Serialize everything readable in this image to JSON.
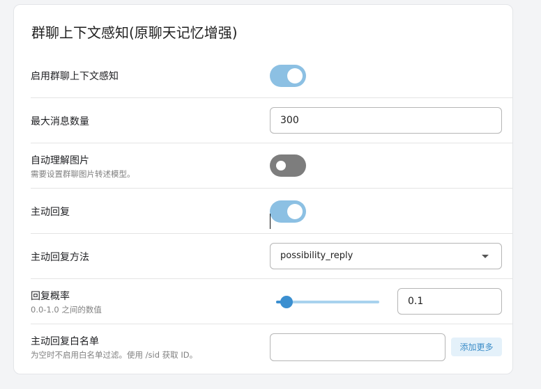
{
  "section": {
    "title": "群聊上下文感知(原聊天记忆增强)"
  },
  "settings": {
    "enable_context": {
      "label": "启用群聊上下文感知",
      "value": true
    },
    "max_messages": {
      "label": "最大消息数量",
      "value": "300"
    },
    "image_understanding": {
      "label": "自动理解图片",
      "description": "需要设置群聊图片转述模型。",
      "value": false
    },
    "active_reply": {
      "label": "主动回复",
      "value": true
    },
    "reply_method": {
      "label": "主动回复方法",
      "selected": "possibility_reply"
    },
    "reply_probability": {
      "label": "回复概率",
      "description": "0.0-1.0 之间的数值",
      "value": "0.1",
      "slider_level": 0.1
    },
    "whitelist": {
      "label": "主动回复白名单",
      "description": "为空时不启用白名单过滤。使用 /sid 获取 ID。",
      "value": "",
      "add_button": "添加更多"
    }
  },
  "colors": {
    "toggle_on": "#8cc0e3",
    "toggle_off": "#7d7d7d",
    "accent": "#3b8fd0"
  }
}
